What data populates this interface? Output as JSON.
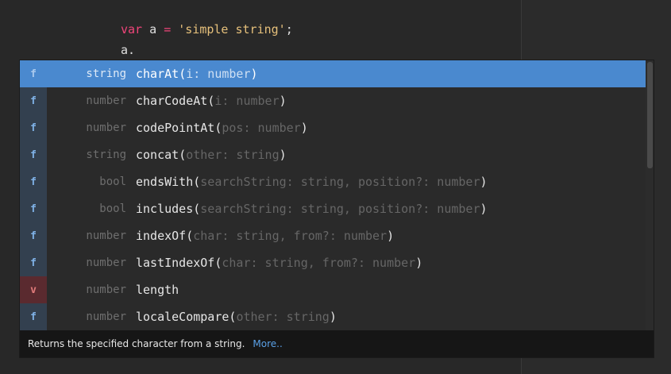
{
  "code": {
    "line1": {
      "keyword": "var",
      "ident": " a ",
      "op": "=",
      "space": " ",
      "string": "'simple string'",
      "end": ";"
    },
    "line2": {
      "text": "a."
    }
  },
  "completions": [
    {
      "kind": "f",
      "type": "string",
      "name": "charAt",
      "open": "(",
      "params": "i: number",
      "close": ")",
      "selected": true
    },
    {
      "kind": "f",
      "type": "number",
      "name": "charCodeAt",
      "open": "(",
      "params": "i: number",
      "close": ")"
    },
    {
      "kind": "f",
      "type": "number",
      "name": "codePointAt",
      "open": "(",
      "params": "pos: number",
      "close": ")"
    },
    {
      "kind": "f",
      "type": "string",
      "name": "concat",
      "open": "(",
      "params": "other: string",
      "close": ")"
    },
    {
      "kind": "f",
      "type": "bool",
      "name": "endsWith",
      "open": "(",
      "params": "searchString: string, position?: number",
      "close": ")"
    },
    {
      "kind": "f",
      "type": "bool",
      "name": "includes",
      "open": "(",
      "params": "searchString: string, position?: number",
      "close": ")"
    },
    {
      "kind": "f",
      "type": "number",
      "name": "indexOf",
      "open": "(",
      "params": "char: string, from?: number",
      "close": ")"
    },
    {
      "kind": "f",
      "type": "number",
      "name": "lastIndexOf",
      "open": "(",
      "params": "char: string, from?: number",
      "close": ")"
    },
    {
      "kind": "v",
      "type": "number",
      "name": "length",
      "open": "",
      "params": "",
      "close": ""
    },
    {
      "kind": "f",
      "type": "number",
      "name": "localeCompare",
      "open": "(",
      "params": "other: string",
      "close": ")"
    }
  ],
  "footer": {
    "description": "Returns the specified character from a string.",
    "more_link": "More.."
  },
  "colors": {
    "selection": "#4a89cf",
    "function_kind_bg": "#33404f",
    "variable_kind_bg": "#5a2a2f",
    "keyword": "#f0457a",
    "string": "#e6c07b"
  }
}
